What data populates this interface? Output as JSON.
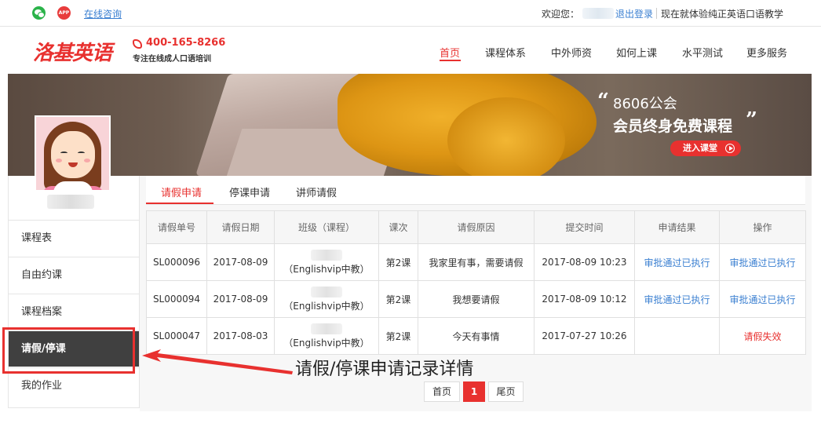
{
  "topbar": {
    "consult_link": "在线咨询",
    "app_badge": "APP",
    "welcome": "欢迎您：",
    "logout": "退出登录",
    "slogan": "现在就体验纯正英语口语教学"
  },
  "header": {
    "logo": "洛基英语",
    "phone": "400-165-8266",
    "phone_sub": "专注在线成人口语培训",
    "nav": [
      "首页",
      "课程体系",
      "中外师资",
      "如何上课",
      "水平测试",
      "更多服务"
    ]
  },
  "banner": {
    "quote_open": "“",
    "line1": "8606公会",
    "line2": "会员终身免费课程",
    "quote_close": "”",
    "enter_button": "进入课堂"
  },
  "sidebar": {
    "items": [
      "课程表",
      "自由约课",
      "课程档案",
      "请假/停课",
      "我的作业"
    ]
  },
  "tabs": [
    "请假申请",
    "停课申请",
    "讲师请假"
  ],
  "table": {
    "headers": [
      "请假单号",
      "请假日期",
      "班级（课程）",
      "课次",
      "请假原因",
      "提交时间",
      "申请结果",
      "操作"
    ],
    "rows": [
      [
        "SL000096",
        "2017-08-09",
        "（Englishvip中教）",
        "第2课",
        "我家里有事，需要请假",
        "2017-08-09 10:23",
        "审批通过已执行",
        "审批通过已执行"
      ],
      [
        "SL000094",
        "2017-08-09",
        "（Englishvip中教）",
        "第2课",
        "我想要请假",
        "2017-08-09 10:12",
        "审批通过已执行",
        "审批通过已执行"
      ],
      [
        "SL000047",
        "2017-08-03",
        "（Englishvip中教）",
        "第2课",
        "今天有事情",
        "2017-07-27 10:26",
        "",
        "请假失效"
      ]
    ]
  },
  "pagination": {
    "first": "首页",
    "current": "1",
    "last": "尾页"
  },
  "annotation": {
    "text": "请假/停课申请记录详情",
    "color": "#e8312f"
  },
  "colors": {
    "brand": "#e8312f",
    "link": "#3a7fd1",
    "active_sidebar": "#404040"
  }
}
